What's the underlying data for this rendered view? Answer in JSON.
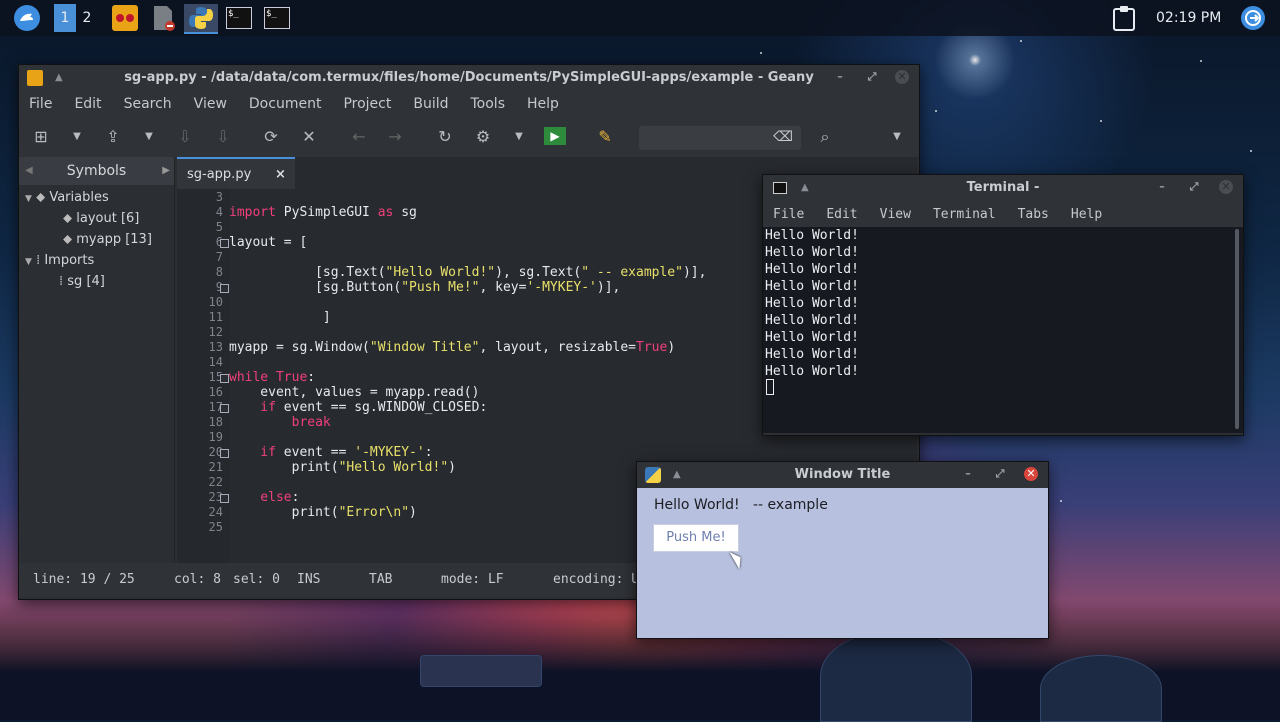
{
  "taskbar": {
    "workspaces": [
      "1",
      "2"
    ],
    "clock": "02:19 PM",
    "apps": [
      {
        "icon": "launcher-icon"
      },
      {
        "icon": "geany-icon"
      },
      {
        "icon": "file-manager-icon"
      },
      {
        "icon": "python-icon"
      },
      {
        "icon": "terminal-icon",
        "glyph": "$_"
      },
      {
        "icon": "terminal-icon",
        "glyph": "$_"
      }
    ]
  },
  "geany": {
    "title": "sg-app.py - /data/data/com.termux/files/home/Documents/PySimpleGUI-apps/example - Geany",
    "menu": [
      "File",
      "Edit",
      "Search",
      "View",
      "Document",
      "Project",
      "Build",
      "Tools",
      "Help"
    ],
    "sidebar_tab": "Symbols",
    "tree": {
      "variables": "Variables",
      "layout": "layout [6]",
      "myapp": "myapp [13]",
      "imports": "Imports",
      "sg": "sg [4]"
    },
    "editor_tab": "sg-app.py",
    "line_numbers": [
      "3",
      "4",
      "5",
      "6",
      "7",
      "8",
      "9",
      "10",
      "11",
      "12",
      "13",
      "14",
      "15",
      "16",
      "17",
      "18",
      "19",
      "20",
      "21",
      "22",
      "23",
      "24",
      "25"
    ],
    "code": {
      "l4_kw": "import",
      "l4_a": " PySimpleGUI ",
      "l4_as": "as",
      "l4_b": " sg",
      "l6": "layout = [",
      "l8_a": "           [sg.Text(",
      "l8_s1": "\"Hello World!\"",
      "l8_b": "), sg.Text(",
      "l8_s2": "\" -- example\"",
      "l8_c": ")],",
      "l9_a": "           [sg.Button(",
      "l9_s1": "\"Push Me!\"",
      "l9_b": ", key=",
      "l9_s2": "'-MYKEY-'",
      "l9_c": ")],",
      "l11": "            ]",
      "l13_a": "myapp = sg.Window(",
      "l13_s": "\"Window Title\"",
      "l13_b": ", layout, resizable=",
      "l13_t": "True",
      "l13_c": ")",
      "l15_kw": "while",
      "l15_t": " True",
      "l15_c": ":",
      "l16": "    event, values = myapp.read()",
      "l17_kw": "    if",
      "l17_b": " event == sg.WINDOW_CLOSED:",
      "l18_kw": "        break",
      "l20_kw": "    if",
      "l20_b": " event == ",
      "l20_s": "'-MYKEY-'",
      "l20_c": ":",
      "l21_a": "        print(",
      "l21_s": "\"Hello World!\"",
      "l21_c": ")",
      "l23_kw": "    else",
      "l23_c": ":",
      "l24_a": "        print(",
      "l24_s": "\"Error\\n\"",
      "l24_c": ")"
    },
    "status": {
      "line": "line: 19 / 25",
      "col": "col: 8",
      "sel": "sel: 0",
      "ins": "INS",
      "tab": "TAB",
      "mode": "mode: LF",
      "encoding": "encoding: U"
    }
  },
  "terminal": {
    "title": "Terminal -",
    "menu": [
      "File",
      "Edit",
      "View",
      "Terminal",
      "Tabs",
      "Help"
    ],
    "output": "Hello World!\nHello World!\nHello World!\nHello World!\nHello World!\nHello World!\nHello World!\nHello World!\nHello World!"
  },
  "psg_window": {
    "title": "Window Title",
    "text1": "Hello World!",
    "text2": "-- example",
    "button": "Push Me!"
  },
  "colors": {
    "accent": "#4a90d9",
    "keyword": "#f0407a",
    "string": "#e8e06a",
    "psg_bg": "#b7c0de"
  }
}
